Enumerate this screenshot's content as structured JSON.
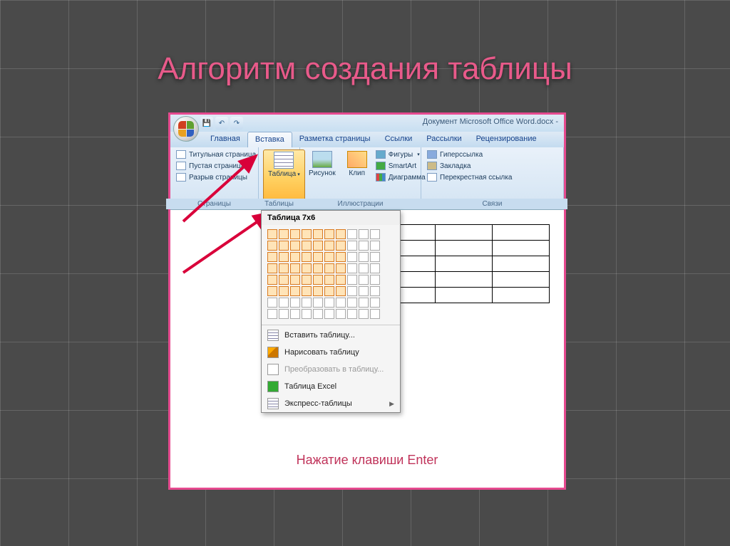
{
  "title": "Алгоритм создания таблицы",
  "caption": "Нажатие клавиши Enter",
  "doc_title": "Документ Microsoft Office Word.docx -",
  "tabs": [
    "Главная",
    "Вставка",
    "Разметка страницы",
    "Ссылки",
    "Рассылки",
    "Рецензирование"
  ],
  "active_tab": "Вставка",
  "groups": {
    "pages": {
      "label": "Страницы",
      "items": [
        "Титульная страница",
        "Пустая страница",
        "Разрыв страницы"
      ]
    },
    "tables": {
      "label": "Таблицы",
      "btn": "Таблица"
    },
    "illustrations": {
      "label": "Иллюстрации",
      "big": [
        "Рисунок",
        "Клип"
      ],
      "small": [
        "Фигуры",
        "SmartArt",
        "Диаграмма"
      ]
    },
    "links": {
      "label": "Связи",
      "items": [
        "Гиперссылка",
        "Закладка",
        "Перекрестная ссылка"
      ]
    }
  },
  "dropdown": {
    "title": "Таблица 7x6",
    "items": [
      {
        "label": "Вставить таблицу...",
        "icon": "table"
      },
      {
        "label": "Нарисовать таблицу",
        "icon": "pencil"
      },
      {
        "label": "Преобразовать в таблицу...",
        "disabled": true
      },
      {
        "label": "Таблица Excel",
        "icon": "excel"
      },
      {
        "label": "Экспресс-таблицы",
        "arrow": true
      }
    ],
    "sel_cols": 7,
    "sel_rows": 6,
    "grid_cols": 10,
    "grid_rows": 8
  },
  "qat": [
    "💾",
    "↶",
    "↷"
  ]
}
